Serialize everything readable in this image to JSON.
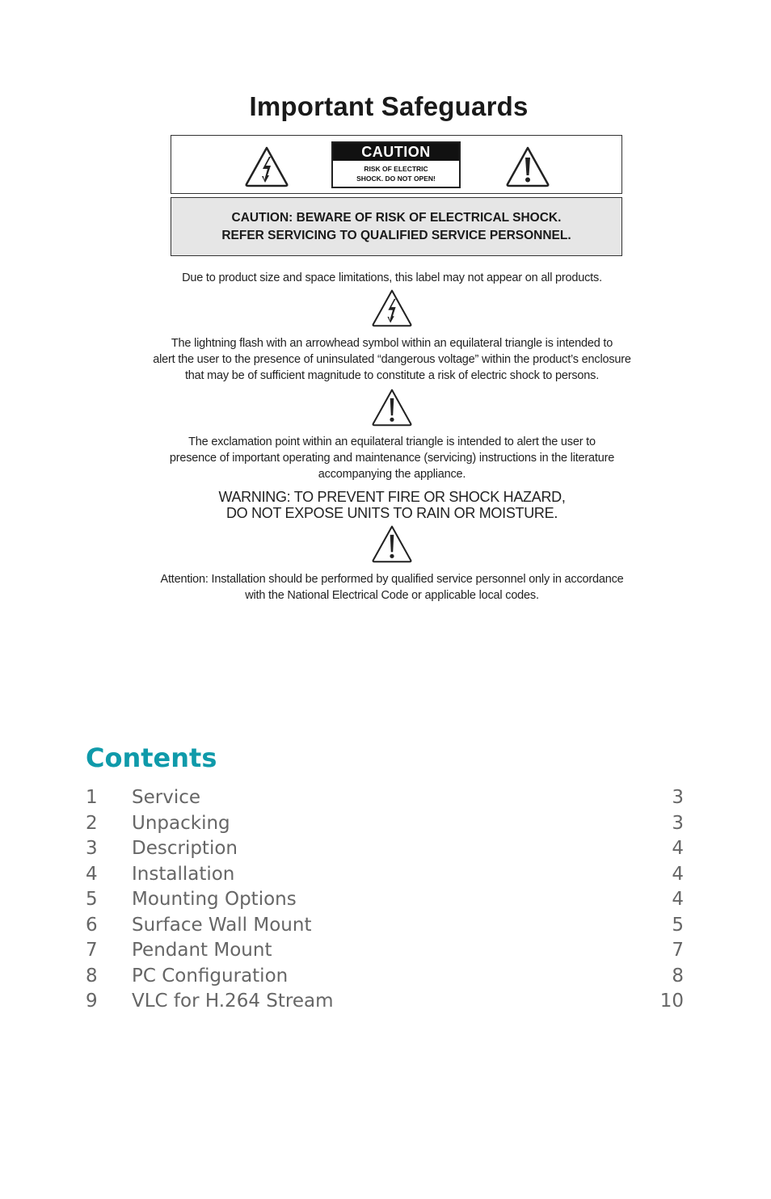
{
  "safeguards": {
    "title": "Important Safeguards",
    "caution_badge": {
      "heading": "CAUTION",
      "line1": "RISK OF ELECTRIC",
      "line2": "SHOCK. DO NOT OPEN!"
    },
    "banner": {
      "line1": "CAUTION: BEWARE OF RISK OF ELECTRICAL SHOCK.",
      "line2": "REFER SERVICING TO QUALIFIED SERVICE PERSONNEL."
    },
    "label_note": "Due to product size and space limitations, this label may not appear on all products.",
    "lightning_text": {
      "line1": "The lightning flash with an arrowhead symbol within an equilateral triangle is intended to",
      "line2": "alert the user to the presence of uninsulated “dangerous voltage” within the product’s enclosure",
      "line3": "that may be of sufficient magnitude to constitute a risk of electric shock to persons."
    },
    "exclamation_text": {
      "line1": "The exclamation point within an equilateral triangle is intended to alert the user to",
      "line2": "presence of important operating and maintenance (servicing) instructions in the literature",
      "line3": "accompanying the appliance."
    },
    "warning": {
      "line1": "WARNING: TO PREVENT FIRE OR SHOCK HAZARD,",
      "line2": "DO NOT EXPOSE UNITS TO RAIN OR MOISTURE."
    },
    "attention": {
      "line1": "Attention: Installation should be performed by qualified service personnel only in accordance",
      "line2": "with the National Electrical Code or applicable local codes."
    },
    "icons": {
      "lightning": "lightning-warning-triangle-icon",
      "exclamation": "exclamation-warning-triangle-icon"
    }
  },
  "contents": {
    "title": "Contents",
    "accent_color": "#0f9aaa",
    "items": [
      {
        "num": "1",
        "label": "Service",
        "page": "3"
      },
      {
        "num": "2",
        "label": "Unpacking",
        "page": "3"
      },
      {
        "num": "3",
        "label": "Description",
        "page": "4"
      },
      {
        "num": "4",
        "label": "Installation",
        "page": "4"
      },
      {
        "num": "5",
        "label": "Mounting Options",
        "page": "4"
      },
      {
        "num": "6",
        "label": "Surface Wall Mount",
        "page": "5"
      },
      {
        "num": "7",
        "label": "Pendant Mount",
        "page": "7"
      },
      {
        "num": "8",
        "label": "PC Configuration",
        "page": "8"
      },
      {
        "num": "9",
        "label": "VLC for H.264 Stream",
        "page": "10"
      }
    ]
  }
}
